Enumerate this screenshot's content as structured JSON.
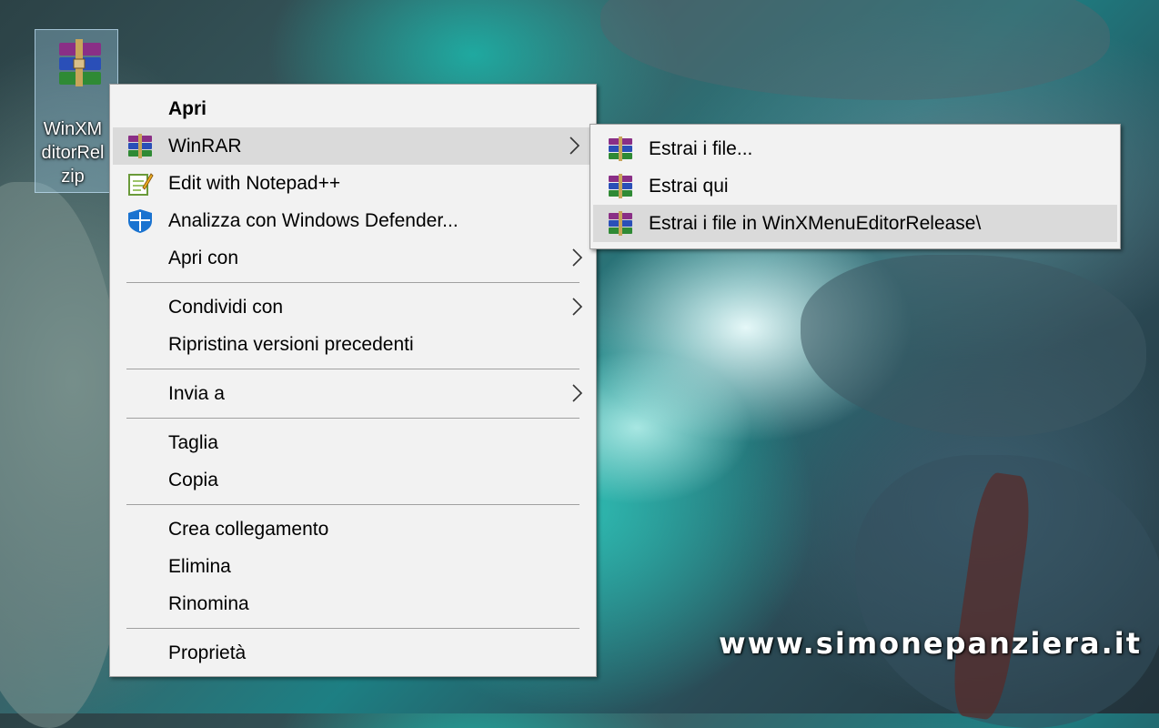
{
  "desktop": {
    "icon_label_lines": "WinXM\nditorRel\nzip",
    "watermark": "www.simonepanziera.it"
  },
  "context_menu": {
    "items": [
      {
        "label": "Apri"
      },
      {
        "label": "WinRAR"
      },
      {
        "label": "Edit with Notepad++"
      },
      {
        "label": "Analizza con Windows Defender..."
      },
      {
        "label": "Apri con"
      },
      {
        "label": "Condividi con"
      },
      {
        "label": "Ripristina versioni precedenti"
      },
      {
        "label": "Invia a"
      },
      {
        "label": "Taglia"
      },
      {
        "label": "Copia"
      },
      {
        "label": "Crea collegamento"
      },
      {
        "label": "Elimina"
      },
      {
        "label": "Rinomina"
      },
      {
        "label": "Proprietà"
      }
    ]
  },
  "winrar_submenu": {
    "items": [
      {
        "label": "Estrai i file..."
      },
      {
        "label": "Estrai qui"
      },
      {
        "label": "Estrai i file in WinXMenuEditorRelease\\"
      }
    ]
  },
  "colors": {
    "menu_bg": "#f2f2f2",
    "highlight": "#dadada",
    "separator": "#a0a0a0",
    "defender_blue": "#1a73d0"
  },
  "icons": [
    "winrar-icon",
    "notepadpp-icon",
    "windows-defender-icon",
    "chevron-right-icon"
  ]
}
